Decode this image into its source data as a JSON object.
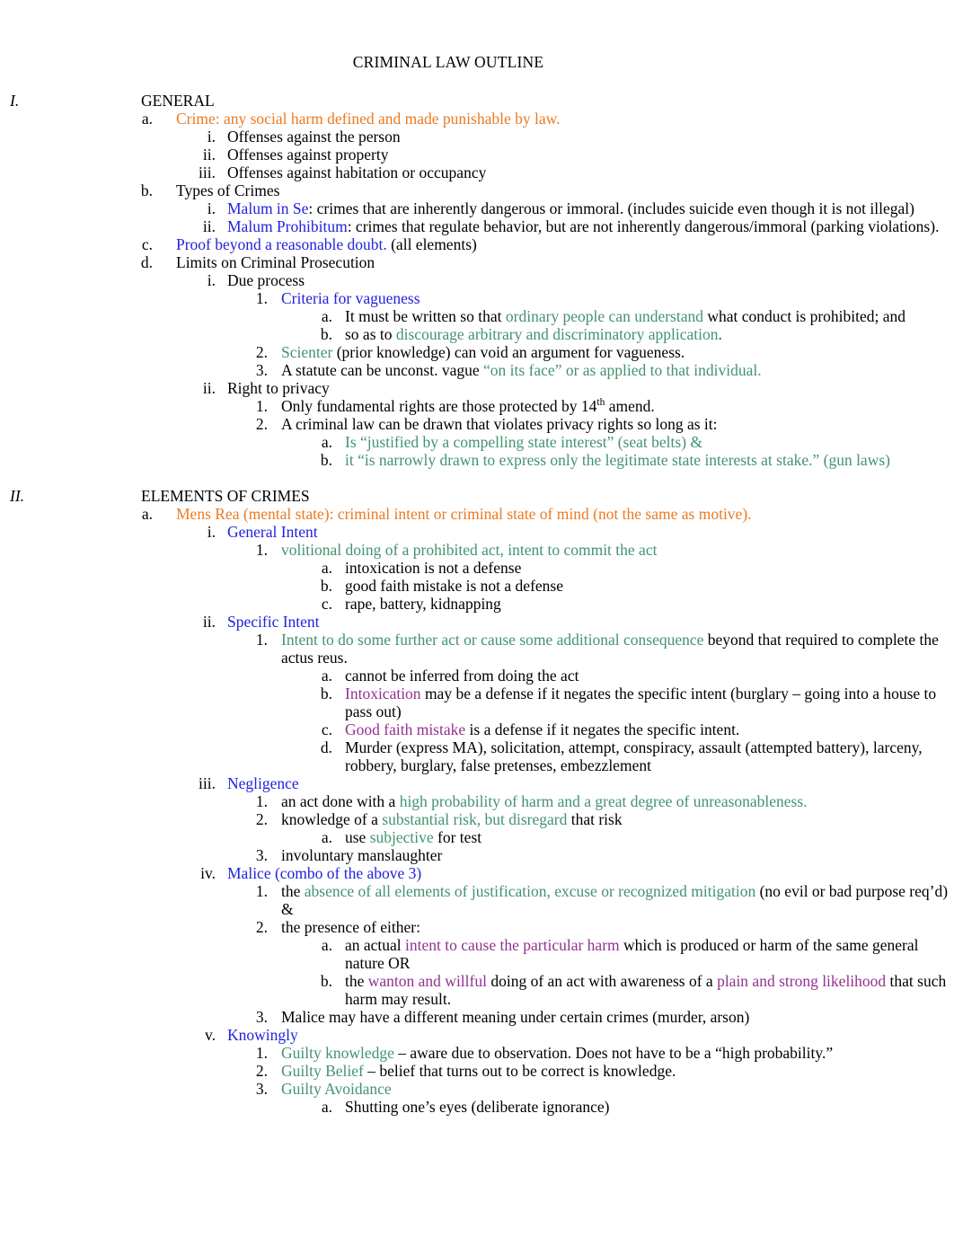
{
  "document": {
    "title": "CRIMINAL LAW OUTLINE"
  },
  "colors": {
    "orange": "#EB7A22",
    "blue": "#2222DD",
    "green": "#43936F",
    "purple": "#93318F",
    "black": "#000000"
  },
  "outline": {
    "s1": {
      "marker": "I.",
      "heading": "GENERAL",
      "a": {
        "marker": "a.",
        "term": "Crime:",
        "text": " any social harm defined and made punishable by law.",
        "i": {
          "marker": "i.",
          "text": "Offenses against the person"
        },
        "ii": {
          "marker": "ii.",
          "text": "Offenses against property"
        },
        "iii": {
          "marker": "iii.",
          "text": "Offenses against habitation or occupancy"
        }
      },
      "b": {
        "marker": "b.",
        "text": "Types of Crimes",
        "i": {
          "marker": "i.",
          "term": "Malum in Se",
          "rest": ":  crimes that are inherently dangerous or immoral.  (includes suicide even though it is not illegal)"
        },
        "ii": {
          "marker": "ii.",
          "term": "Malum Prohibitum",
          "rest": ":  crimes that regulate behavior, but are not inherently dangerous/immoral (parking violations)."
        }
      },
      "c": {
        "marker": "c.",
        "term": "Proof beyond a reasonable doubt.",
        "rest": "   (all elements)"
      },
      "d": {
        "marker": "d.",
        "text": "Limits on Criminal Prosecution",
        "i": {
          "marker": "i.",
          "text": "Due process",
          "n1": {
            "marker": "1.",
            "text": "Criteria for vagueness",
            "a": {
              "marker": "a.",
              "pre": "It must be written so that ",
              "hl": "ordinary people can understand",
              "post": " what conduct is prohibited; and"
            },
            "b": {
              "marker": "b.",
              "pre": "so as to ",
              "hl": "discourage arbitrary and discriminatory application",
              "post": "."
            }
          },
          "n2": {
            "marker": "2.",
            "hl": "Scienter",
            "rest": " (prior knowledge) can void an argument for vagueness."
          },
          "n3": {
            "marker": "3.",
            "pre": "A statute can be unconst. vague ",
            "hl": "“on its face” or as applied to that individual."
          }
        },
        "ii": {
          "marker": "ii.",
          "text": "Right to privacy",
          "n1": {
            "marker": "1.",
            "pre": "Only fundamental rights are those protected by 14",
            "sup": "th",
            "post": " amend."
          },
          "n2": {
            "marker": "2.",
            "text": "A criminal law can be drawn that violates privacy rights so long as it:",
            "a": {
              "marker": "a.",
              "text": "Is “justified by a compelling state interest” (seat belts) &"
            },
            "b": {
              "marker": "b.",
              "text": "it “is narrowly drawn to express only the legitimate state interests at stake.” (gun laws)"
            }
          }
        }
      }
    },
    "s2": {
      "marker": "II.",
      "heading": "ELEMENTS OF CRIMES",
      "a": {
        "marker": "a.",
        "term": "Mens Rea  (mental state):",
        "rest": "  criminal intent or criminal state of mind (not the same as motive).",
        "i": {
          "marker": "i.",
          "text": "General Intent",
          "n1": {
            "marker": "1.",
            "text": "volitional doing of a prohibited act, intent to commit the act",
            "a": {
              "marker": "a.",
              "text": "intoxication is not a defense"
            },
            "b": {
              "marker": "b.",
              "text": "good faith mistake is not a defense"
            },
            "c": {
              "marker": "c.",
              "text": "rape, battery, kidnapping"
            }
          }
        },
        "ii": {
          "marker": "ii.",
          "text": "Specific Intent",
          "n1": {
            "marker": "1.",
            "hl": "Intent to do some further act or cause some additional consequence",
            "rest": " beyond that required to complete the actus reus.",
            "a": {
              "marker": "a.",
              "text": "cannot be inferred from doing the act"
            },
            "b": {
              "marker": "b.",
              "hl": "Intoxication",
              "rest": " may be a defense if it negates the specific intent (burglary – going into a house to pass out)"
            },
            "c": {
              "marker": "c.",
              "hl": "Good faith mistake",
              "rest": " is a defense if it negates the specific intent."
            },
            "d": {
              "marker": "d.",
              "text": "Murder (express MA), solicitation, attempt, conspiracy, assault (attempted battery), larceny, robbery, burglary, false pretenses, embezzlement"
            }
          }
        },
        "iii": {
          "marker": "iii.",
          "text": "Negligence",
          "n1": {
            "marker": "1.",
            "pre": "an act done with a ",
            "hl": "high probability of harm and a great degree of unreasonableness."
          },
          "n2": {
            "marker": "2.",
            "pre": "knowledge of a ",
            "hl": "substantial risk, but disregard",
            "post": " that risk",
            "a": {
              "marker": "a.",
              "pre": "use ",
              "hl": "subjective",
              "post": " for test"
            }
          },
          "n3": {
            "marker": "3.",
            "text": "involuntary manslaughter"
          }
        },
        "iv": {
          "marker": "iv.",
          "text": "Malice (combo of the above 3)",
          "n1": {
            "marker": "1.",
            "pre": "the ",
            "hl": "absence of all elements of justification, excuse or recognized mitigation",
            "post": " (no evil or bad purpose req’d) &"
          },
          "n2": {
            "marker": "2.",
            "text": "the presence of either:",
            "a": {
              "marker": "a.",
              "pre": "an actual ",
              "hl": "intent to cause the particular harm",
              "post": " which is produced or harm of the same general nature OR"
            },
            "b": {
              "marker": "b.",
              "pre": "the ",
              "hl1": "wanton and willful",
              "mid": " doing of an act with awareness of a ",
              "hl2": "plain and strong likelihood",
              "post": " that such harm may result."
            }
          },
          "n3": {
            "marker": "3.",
            "text": "Malice may have a different meaning under certain crimes (murder, arson)"
          }
        },
        "v": {
          "marker": "v.",
          "text": "Knowingly",
          "n1": {
            "marker": "1.",
            "hl": "Guilty knowledge",
            "rest": " – aware due to observation.  Does not have to be a “high probability.”"
          },
          "n2": {
            "marker": "2.",
            "hl": "Guilty Belief",
            "rest": " – belief that turns out to be correct is knowledge."
          },
          "n3": {
            "marker": "3.",
            "hl": "Guilty Avoidance",
            "a": {
              "marker": "a.",
              "text": "Shutting one’s eyes (deliberate ignorance)"
            }
          }
        }
      }
    }
  }
}
